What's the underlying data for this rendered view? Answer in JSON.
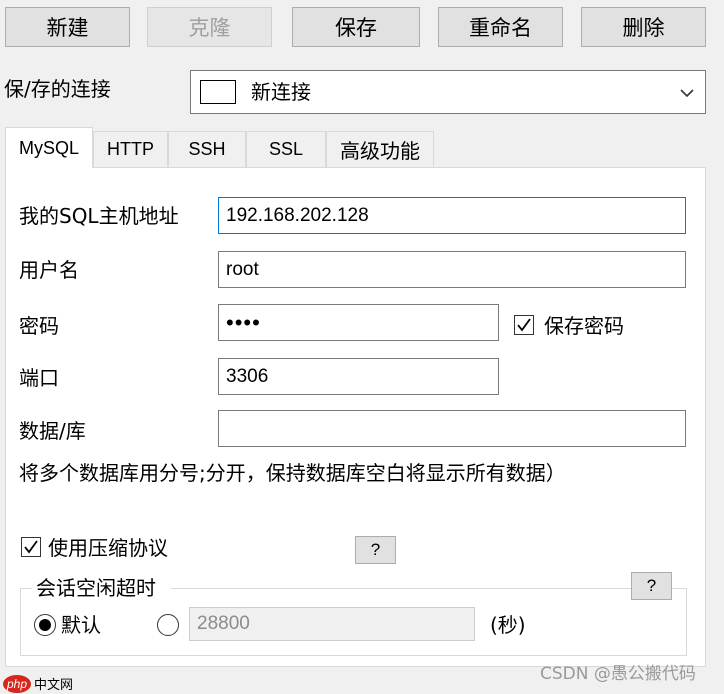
{
  "toolbar": {
    "new_label": "新建",
    "clone_label": "克隆",
    "save_label": "保存",
    "rename_label": "重命名",
    "delete_label": "删除"
  },
  "connection": {
    "label": "保/存的连接",
    "selected": "新连接"
  },
  "tabs": [
    {
      "label": "MySQL",
      "active": true
    },
    {
      "label": "HTTP",
      "active": false
    },
    {
      "label": "SSH",
      "active": false
    },
    {
      "label": "SSL",
      "active": false
    },
    {
      "label": "高级功能",
      "active": false
    }
  ],
  "form": {
    "host_label": "我的SQL主机地址",
    "host_value": "192.168.202.128",
    "user_label": "用户名",
    "user_value": "root",
    "password_label": "密码",
    "password_value": "••••",
    "save_password_label": "保存密码",
    "save_password_checked": true,
    "port_label": "端口",
    "port_value": "3306",
    "database_label": "数据/库",
    "database_value": "",
    "hint": "将多个数据库用分号;分开，保持数据库空白将显示所有数据）",
    "compression_label": "使用压缩协议",
    "compression_checked": true,
    "help_label": "?"
  },
  "timeout": {
    "group_label": "会话空闲超时",
    "help_label": "?",
    "default_label": "默认",
    "default_selected": true,
    "custom_value": "28800",
    "unit_label": "(秒)"
  },
  "watermark": {
    "csdn": "CSDN @愚公搬代码",
    "php_logo": "php中文网"
  }
}
